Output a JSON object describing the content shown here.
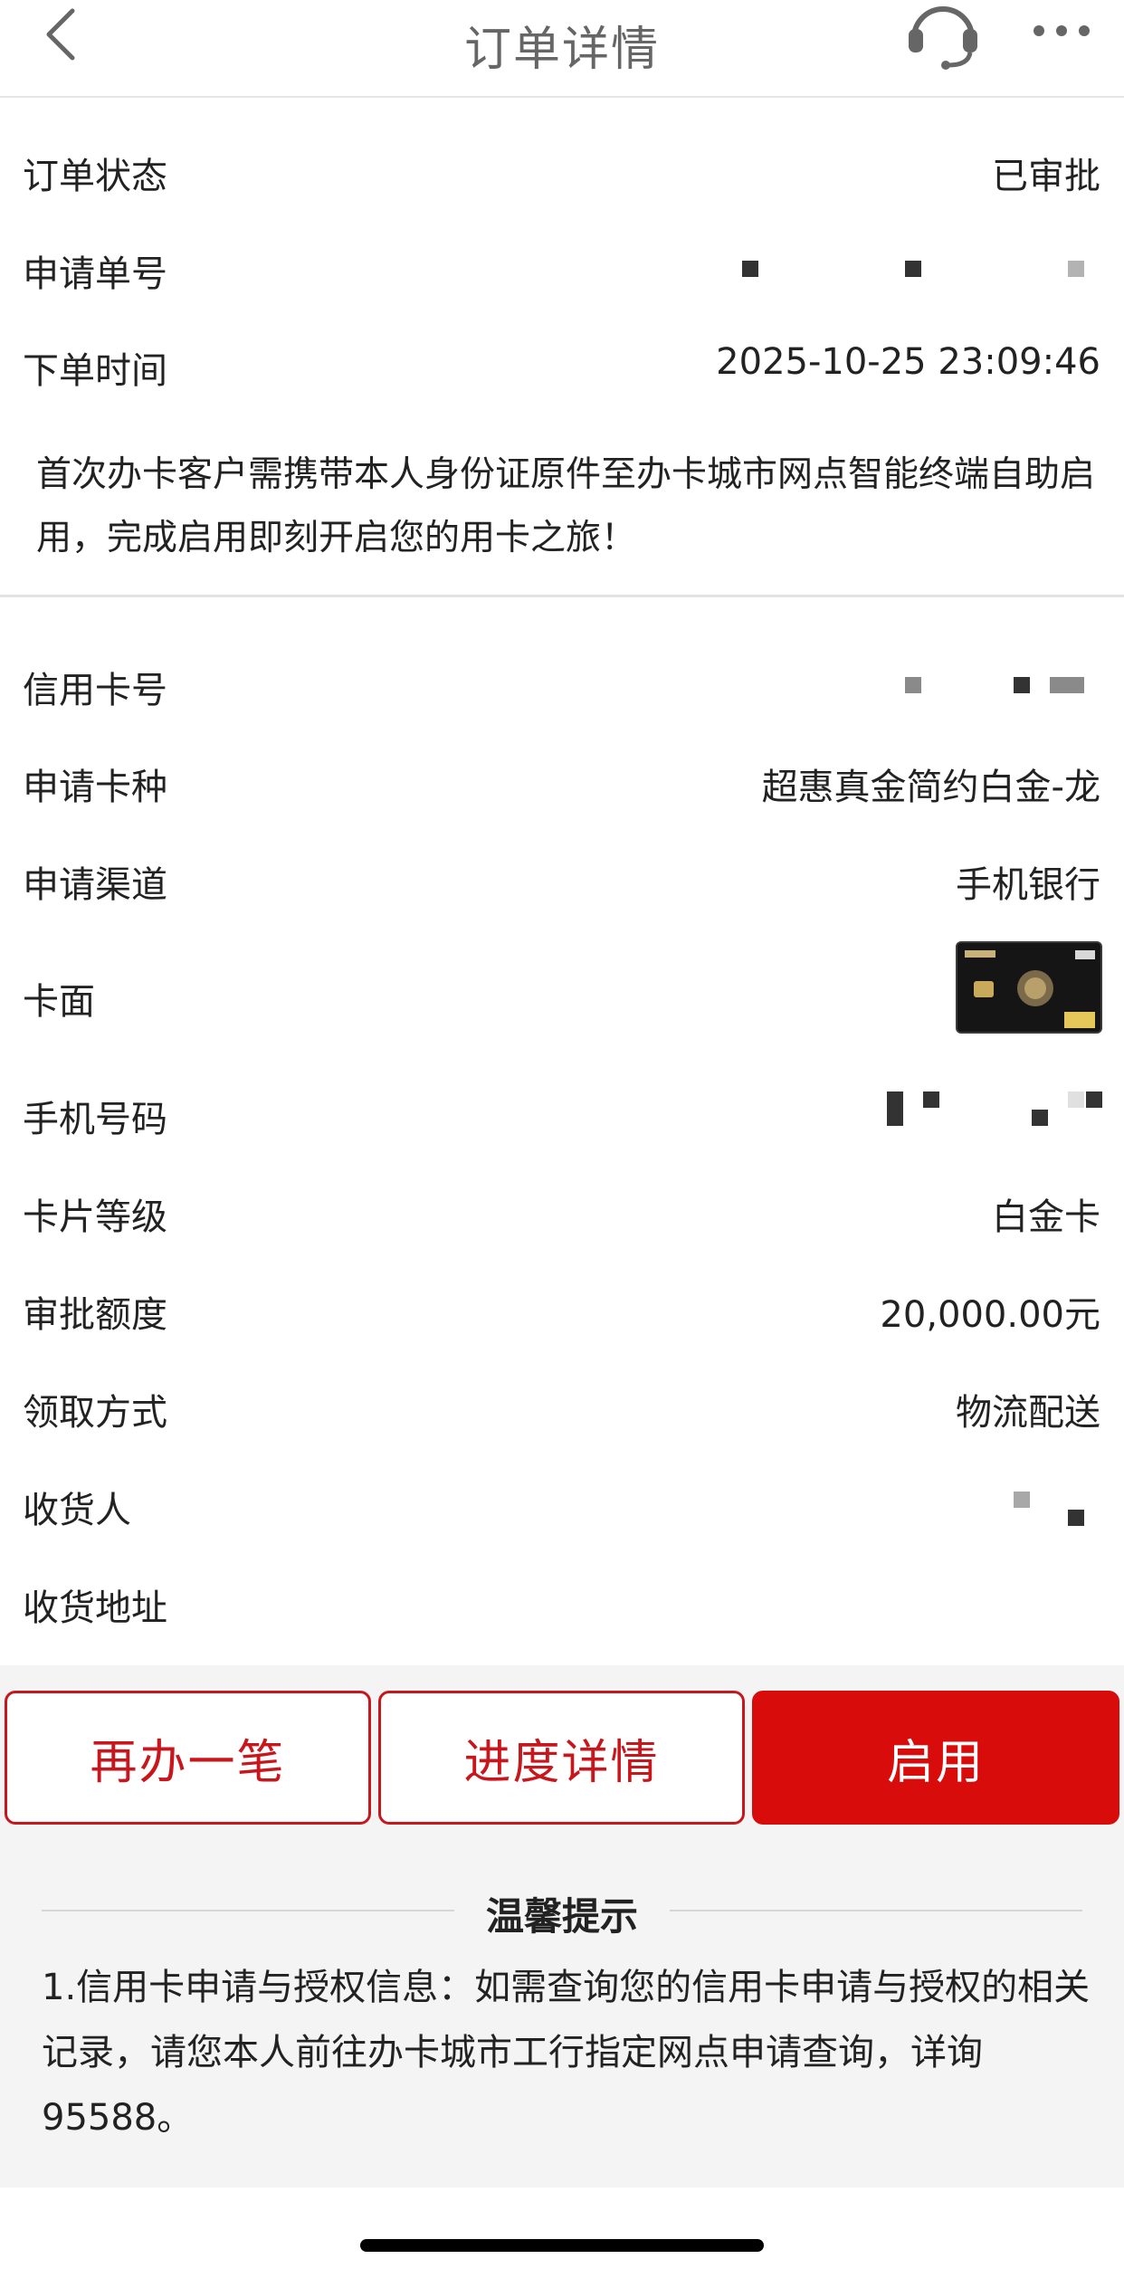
{
  "header": {
    "title": "订单详情",
    "back_icon": "chevron-left-icon",
    "service_icon": "headset-icon",
    "more_icon": "more-dots-icon"
  },
  "order": {
    "status_label": "订单状态",
    "status_value": "已审批",
    "number_label": "申请单号",
    "time_label": "下单时间",
    "time_value": "2025-10-25 23:09:46"
  },
  "notice": "首次办卡客户需携带本人身份证原件至办卡城市网点智能终端自助启用，完成启用即刻开启您的用卡之旅！",
  "card": {
    "card_no_label": "信用卡号",
    "type_label": "申请卡种",
    "type_value": "超惠真金简约白金-龙",
    "channel_label": "申请渠道",
    "channel_value": "手机银行",
    "face_label": "卡面",
    "phone_label": "手机号码",
    "level_label": "卡片等级",
    "level_value": "白金卡",
    "limit_label": "审批额度",
    "limit_value": "20,000.00元",
    "pickup_label": "领取方式",
    "pickup_value": "物流配送",
    "receiver_label": "收货人",
    "address_label": "收货地址"
  },
  "buttons": {
    "again": "再办一笔",
    "progress": "进度详情",
    "activate": "启用"
  },
  "tips": {
    "title": "温馨提示",
    "text": "1.信用卡申请与授权信息：如需查询您的信用卡申请与授权的相关记录，请您本人前往办卡城市工行指定网点申请查询，详询95588。"
  },
  "colors": {
    "accent": "#d90c0c",
    "outline": "#c8161d"
  }
}
